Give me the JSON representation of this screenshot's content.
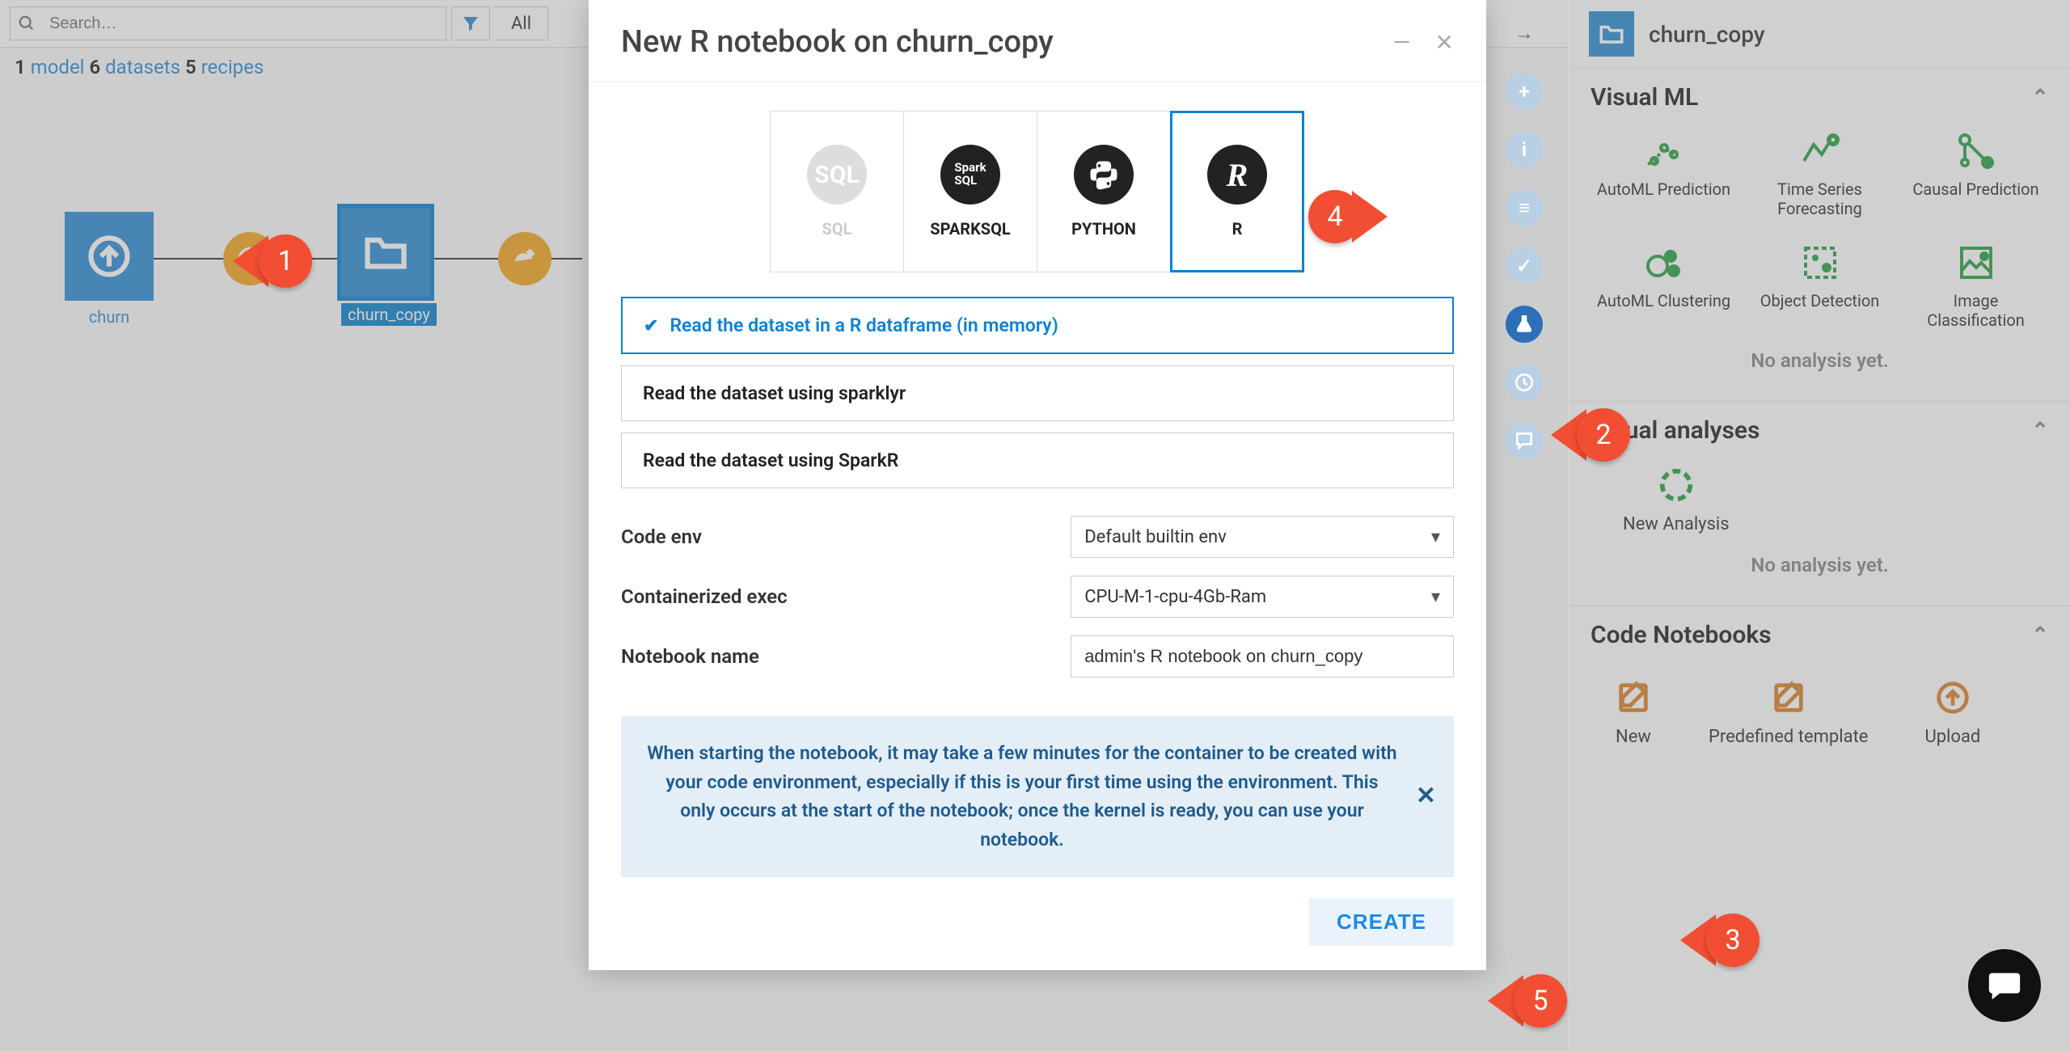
{
  "toolbar": {
    "search_placeholder": "Search…",
    "filter_label": "All"
  },
  "crumbs": {
    "models": "1",
    "model_word": "model",
    "datasets": "6",
    "dataset_word": "datasets",
    "recipes": "5",
    "recipe_word": "recipes"
  },
  "flow": {
    "nodes": [
      {
        "id": "churn",
        "label": "churn"
      },
      {
        "id": "churn_copy",
        "label": "churn_copy"
      }
    ]
  },
  "modal": {
    "title": "New R notebook on churn_copy",
    "kernels": [
      "SQL",
      "SPARKSQL",
      "PYTHON",
      "R"
    ],
    "selected_kernel": "R",
    "options": [
      "Read the dataset in a R dataframe (in memory)",
      "Read the dataset using sparklyr",
      "Read the dataset using SparkR"
    ],
    "selected_option_index": 0,
    "form": {
      "code_env_label": "Code env",
      "code_env_value": "Default builtin env",
      "container_label": "Containerized exec",
      "container_value": "CPU-M-1-cpu-4Gb-Ram",
      "name_label": "Notebook name",
      "name_value": "admin's R notebook on churn_copy"
    },
    "info": "When starting the notebook, it may take a few minutes for the container to be created with your code environment, especially if this is your first time using the environment. This only occurs at the start of the notebook; once the kernel is ready, you can use your notebook.",
    "create_label": "CREATE"
  },
  "right": {
    "title": "churn_copy",
    "visual_ml": {
      "title": "Visual ML",
      "items": [
        "AutoML Prediction",
        "Time Series Forecasting",
        "Causal Prediction",
        "AutoML Clustering",
        "Object Detection",
        "Image Classification"
      ],
      "empty": "No analysis yet."
    },
    "visual_analyses": {
      "title": "Visual analyses",
      "new_label": "New Analysis",
      "empty": "No analysis yet."
    },
    "code_notebooks": {
      "title": "Code Notebooks",
      "items": [
        "New",
        "Predefined template",
        "Upload"
      ]
    }
  },
  "callouts": {
    "c1": "1",
    "c2": "2",
    "c3": "3",
    "c4": "4",
    "c5": "5"
  }
}
